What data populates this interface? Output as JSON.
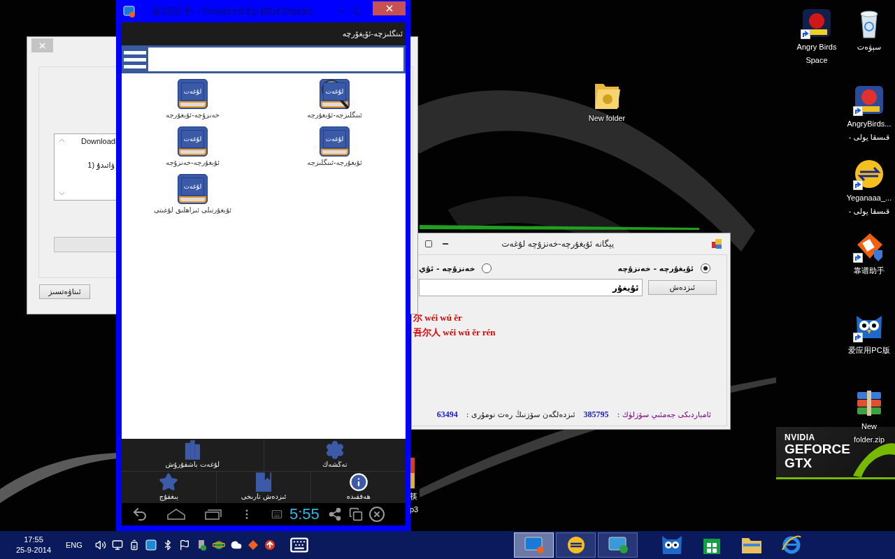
{
  "desktop_icons": [
    {
      "kind": "recycle",
      "shortcut": false,
      "lines": [
        "سېۋەت"
      ]
    },
    {
      "kind": "angry-space",
      "shortcut": true,
      "lines": [
        "Angry Birds",
        "Space"
      ]
    },
    {
      "kind": "folder",
      "shortcut": false,
      "lines": [
        "New folder"
      ]
    },
    {
      "kind": "angry-starwars",
      "shortcut": true,
      "lines": [
        "AngryBirds...",
        "قىسقا يولى -"
      ]
    },
    {
      "kind": "yegana",
      "shortcut": true,
      "lines": [
        "Yeganaaa_...",
        "قىسقا يولى -"
      ]
    },
    {
      "kind": "kaopu",
      "shortcut": true,
      "lines": [
        "靠谱助手"
      ]
    },
    {
      "kind": "owl",
      "shortcut": true,
      "lines": [
        "爱应用PC版"
      ]
    },
    {
      "kind": "zip",
      "shortcut": false,
      "lines": [
        "New",
        "folder.zip"
      ]
    }
  ],
  "partial_icon": {
    "lines": [
      "筷",
      "p3"
    ]
  },
  "nvidia_badge": {
    "brand": "NVIDIA",
    "product": "GEFORCE",
    "series": "GTX"
  },
  "dictionary_window": {
    "title": "يېگانە ئۇيغۇرچە-خەنزۇچە لۇغەت",
    "directions": [
      {
        "label": "ئۇيغۇرچە - خەنزۇچە",
        "selected": true
      },
      {
        "label": "خەنزۇچە - ئۇي",
        "selected": false
      }
    ],
    "search": {
      "value": "ئۇيغۇر"
    },
    "search_button": "ئىزدەش",
    "results": [
      "尔 wéi wú ěr",
      "吾尔人 wéi wú ěr rén"
    ],
    "status": {
      "total_label": "ئامباردىكى جەمئىي سۆزلۈك :",
      "total": "385795",
      "index_label": "ئىزدەلگەن سۆزنىڭ رەت نومۇرى :",
      "index": "63494"
    }
  },
  "download_window": {
    "list_lines": [
      "Downloadi",
      "ۋاتىدۇ (1"
    ],
    "cancel_button": "ئىناۋەتسىز"
  },
  "bluestacks": {
    "title": "靠谱助手 - Powered by BlueStacks",
    "header": "ئىنگلىزچە-ئۇيغۇرچە",
    "dictionaries": [
      {
        "kind": "search-book",
        "cover": "لۇغەت",
        "label": "ئىنگلىزچە-ئۇيغۇرچە"
      },
      {
        "kind": "book",
        "cover": "لۇغەت",
        "label": "خەنزۇچە-ئۇيغۇرچە"
      },
      {
        "kind": "book",
        "cover": "لۇغەت",
        "label": "ئۇيغۇرچە-ئىنگلىزچە"
      },
      {
        "kind": "book",
        "cover": "لۇغەت",
        "label": "ئۇيغۇرچە-خەنزۇچە"
      },
      {
        "kind": "book",
        "cover": "لۇغەت",
        "label": "ئۇيغۇرتىلى ئىزاھلىق لۇغىتى"
      }
    ],
    "menu": [
      {
        "kind": "settings",
        "label": "تەڭشەك"
      },
      {
        "kind": "manage",
        "label": "لۇغەت باشقۇرۇش"
      },
      {
        "kind": "about",
        "label": "ھەققىدە"
      },
      {
        "kind": "history",
        "label": "ئىزدەش تارىخى"
      },
      {
        "kind": "favorites",
        "label": "يىغقۇچ"
      }
    ],
    "clock": "5:55"
  },
  "taskbar": {
    "time": "17:55",
    "date": "25-9-2014",
    "language": "ENG",
    "windows": [
      {
        "kind": "bluestacks",
        "selected": true
      },
      {
        "kind": "yegana",
        "selected": false
      },
      {
        "kind": "sync",
        "selected": false
      }
    ]
  }
}
